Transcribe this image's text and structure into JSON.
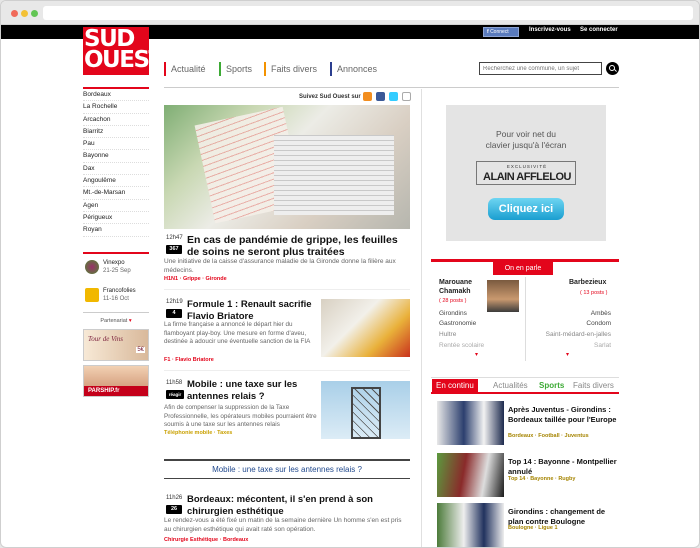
{
  "topbar": {
    "facebook": "Connect",
    "register": "Inscrivez-vous",
    "login": "Se connecter"
  },
  "logo": {
    "line1": "SUD",
    "line2": "OUEST"
  },
  "nav": [
    "Actualité",
    "Sports",
    "Faits divers",
    "Annonces"
  ],
  "nav_colors": [
    "#e3051b",
    "#3daa35",
    "#f39200",
    "#2b3e8f"
  ],
  "search": {
    "placeholder": "Recherchez une commune, un sujet"
  },
  "cities": [
    "Bordeaux",
    "La Rochelle",
    "Arcachon",
    "Biarritz",
    "Pau",
    "Bayonne",
    "Dax",
    "Angoulême",
    "Mt.-de-Marsan",
    "Agen",
    "Périgueux",
    "Royan"
  ],
  "events": [
    {
      "name": "Vinexpo",
      "dates": "21-25 Sep"
    },
    {
      "name": "Francofolies",
      "dates": "11-16 Oct"
    }
  ],
  "partner": {
    "label": "Partenariat",
    "ad1": "Tour de Vins",
    "ad1_price": "5€",
    "ad2": "PARSHIP.fr"
  },
  "follow": "Suivez Sud Ouest sur",
  "articles": [
    {
      "time": "12h47",
      "badge": "367",
      "title": "En cas de pandémie de grippe, les feuilles de soins ne seront plus traitées",
      "desc": "Une initiative de la caisse d'assurance maladie de la Gironde donne la filière aux médecins.",
      "tags": "H1N1 · Grippe · Gironde"
    },
    {
      "time": "12h19",
      "badge": "4",
      "title": "Formule 1 : Renault sacrifie Flavio Briatore",
      "desc": "La firme française a annoncé le départ hier du flamboyant play-boy. Une mesure en forme d'aveu, destinée à adoucir une éventuelle sanction de la FIA",
      "tags": "F1 · Flavio Briatore"
    },
    {
      "time": "11h58",
      "badge": "réagir",
      "title": "Mobile : une taxe sur les antennes relais ?",
      "desc": "Afin de compenser la suppression de la Taxe Professionnelle, les opérateurs mobiles pourraient être soumis à une taxe sur les antennes relais",
      "tags": "Téléphonie mobile · Taxes"
    },
    {
      "time": "11h26",
      "badge": "26",
      "title": "Bordeaux: mécontent, il s'en prend à son chirurgien esthétique",
      "desc": "Le rendez-vous a été fixé un matin de la semaine dernière Un homme s'en est pris au chirurgien esthétique qui avait raté son opération.",
      "tags": "Chirurgie Esthétique · Bordeaux"
    }
  ],
  "related": "Mobile : une taxe sur les antennes relais ?",
  "ad": {
    "line1": "Pour voir net du",
    "line2": "clavier jusqu'à l'écran",
    "small": "EXCLUSIVITÉ",
    "brand": "ALAIN AFFLELOU",
    "button": "Cliquez ici"
  },
  "onparle": {
    "tab": "On en parle",
    "left_name1": "Marouane",
    "left_name2": "Chamakh",
    "left_posts": "( 28 posts )",
    "right_name": "Barbezieux",
    "right_posts": "( 13 posts )",
    "left_items": [
      "Girondins",
      "Gastronomie",
      "Hultre",
      "Rentée scolaire"
    ],
    "right_items": [
      "Ambès",
      "Condom",
      "Saint-médard-en-jalles",
      "Sarlat"
    ]
  },
  "continu": {
    "tabs": [
      "En continu",
      "Actualités",
      "Sports",
      "Faits divers"
    ],
    "items": [
      {
        "title": "Après Juventus - Girondins : Bordeaux taillée pour l'Europe",
        "tags": "Bordeaux · Football · Juventus"
      },
      {
        "title": "Top 14 : Bayonne - Montpellier annulé",
        "tags": "Top 14 · Bayonne · Rugby"
      },
      {
        "title": "Girondins : changement de plan contre Boulogne",
        "tags": "Boulogne · Ligue 1"
      }
    ]
  }
}
